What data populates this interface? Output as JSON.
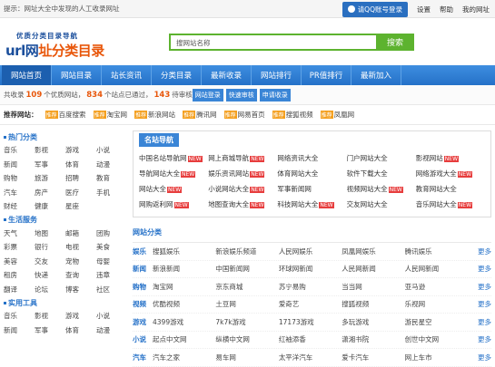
{
  "topbar": {
    "tip": "提示：网址大全中发现的人工收录网址",
    "login_label": "请QQ账号登录",
    "links": [
      "设置",
      "帮助",
      "我的网址"
    ]
  },
  "logo": {
    "small": "优质分类目录导航",
    "big_prefix": "url网",
    "big_main": "址分类目录"
  },
  "search": {
    "value": "搜网站名称",
    "button": "搜索"
  },
  "nav": {
    "items": [
      "网站首页",
      "网站目录",
      "站长资讯",
      "分类目录",
      "最新收录",
      "网站排行",
      "PR值排行",
      "最新加入"
    ],
    "active": 0
  },
  "stats": {
    "t1": "共收录",
    "n1": "109",
    "t2": "个优质网站，",
    "n2": "834",
    "t3": "个站点已通过，",
    "n3": "143",
    "t4": "待审核",
    "buttons": [
      "网站登录",
      "快速审核",
      "申请收录"
    ]
  },
  "recs": {
    "head": "推荐网站：",
    "items": [
      {
        "name": "百度搜索",
        "tag": "推荐"
      },
      {
        "name": "淘宝网",
        "tag": "推荐"
      },
      {
        "name": "新浪网站",
        "tag": "推荐"
      },
      {
        "name": "腾讯网",
        "tag": "推荐"
      },
      {
        "name": "网易首页",
        "tag": "推荐"
      },
      {
        "name": "搜狐视频",
        "tag": "推荐"
      },
      {
        "name": "凤凰网",
        "tag": "推荐"
      },
      {
        "name": "优酷视频",
        "tag": "推荐"
      }
    ]
  },
  "left": {
    "sec1": "热门分类",
    "grid1": [
      "音乐",
      "影视",
      "游戏",
      "小说",
      "新闻",
      "军事",
      "体育",
      "动漫",
      "购物",
      "旅游",
      "招聘",
      "教育",
      "汽车",
      "房产",
      "医疗",
      "手机",
      "财经",
      "健康",
      "星座"
    ],
    "sec2": "生活服务",
    "grid2": [
      "天气",
      "地图",
      "邮箱",
      "团购",
      "彩票",
      "银行",
      "电视",
      "美食",
      "美容",
      "交友",
      "宠物",
      "母婴",
      "租房",
      "快递",
      "查询",
      "违章",
      "翻译",
      "论坛",
      "博客",
      "社区"
    ],
    "sec3": "实用工具",
    "grid3": [
      "音乐",
      "影视",
      "游戏",
      "小说",
      "新闻",
      "军事",
      "体育",
      "动漫"
    ]
  },
  "famous": {
    "tab": "名站导航",
    "items": [
      {
        "name": "中国名站导航网",
        "tag": "NEW"
      },
      {
        "name": "网上商城导航",
        "tag": "NEW"
      },
      {
        "name": "网络资讯大全",
        "tag": ""
      },
      {
        "name": "门户网站大全",
        "tag": ""
      },
      {
        "name": "影视网站",
        "tag": "NEW"
      },
      {
        "name": "导航网站大全",
        "tag": "NEW"
      },
      {
        "name": "娱乐资讯网站",
        "tag": "NEW"
      },
      {
        "name": "体育网站大全",
        "tag": ""
      },
      {
        "name": "软件下载大全",
        "tag": ""
      },
      {
        "name": "网络游戏大全",
        "tag": "NEW"
      },
      {
        "name": "网站大全",
        "tag": "NEW"
      },
      {
        "name": "小说网站大全",
        "tag": "NEW"
      },
      {
        "name": "军事新闻网",
        "tag": ""
      },
      {
        "name": "视频网站大全",
        "tag": "NEW"
      },
      {
        "name": "教育网站大全",
        "tag": ""
      },
      {
        "name": "网购返利网",
        "tag": "NEW"
      },
      {
        "name": "地图查询大全",
        "tag": "NEW"
      },
      {
        "name": "科技网站大全",
        "tag": "NEW"
      },
      {
        "name": "交友网站大全",
        "tag": ""
      },
      {
        "name": "音乐网站大全",
        "tag": "NEW"
      }
    ]
  },
  "categories": {
    "head": "网站分类",
    "more": "更多",
    "rows": [
      {
        "name": "娱乐",
        "cols": [
          "搜狐娱乐",
          "新浪娱乐频道",
          "人民网娱乐",
          "凤凰网娱乐",
          "腾讯娱乐"
        ]
      },
      {
        "name": "新闻",
        "cols": [
          "新浪新闻",
          "中国新闻网",
          "环球网新闻",
          "人民网新闻",
          "人民网新闻"
        ]
      },
      {
        "name": "购物",
        "cols": [
          "淘宝网",
          "京东商城",
          "苏宁易购",
          "当当网",
          "亚马逊"
        ]
      },
      {
        "name": "视频",
        "cols": [
          "优酷视频",
          "土豆网",
          "爱奇艺",
          "搜狐视频",
          "乐视网"
        ]
      },
      {
        "name": "游戏",
        "cols": [
          "4399游戏",
          "7k7k游戏",
          "17173游戏",
          "多玩游戏",
          "游民星空"
        ]
      },
      {
        "name": "小说",
        "cols": [
          "起点中文网",
          "纵横中文网",
          "红袖添香",
          "潇湘书院",
          "创世中文网"
        ]
      },
      {
        "name": "汽车",
        "cols": [
          "汽车之家",
          "易车网",
          "太平洋汽车",
          "爱卡汽车",
          "网上车市"
        ]
      }
    ]
  }
}
